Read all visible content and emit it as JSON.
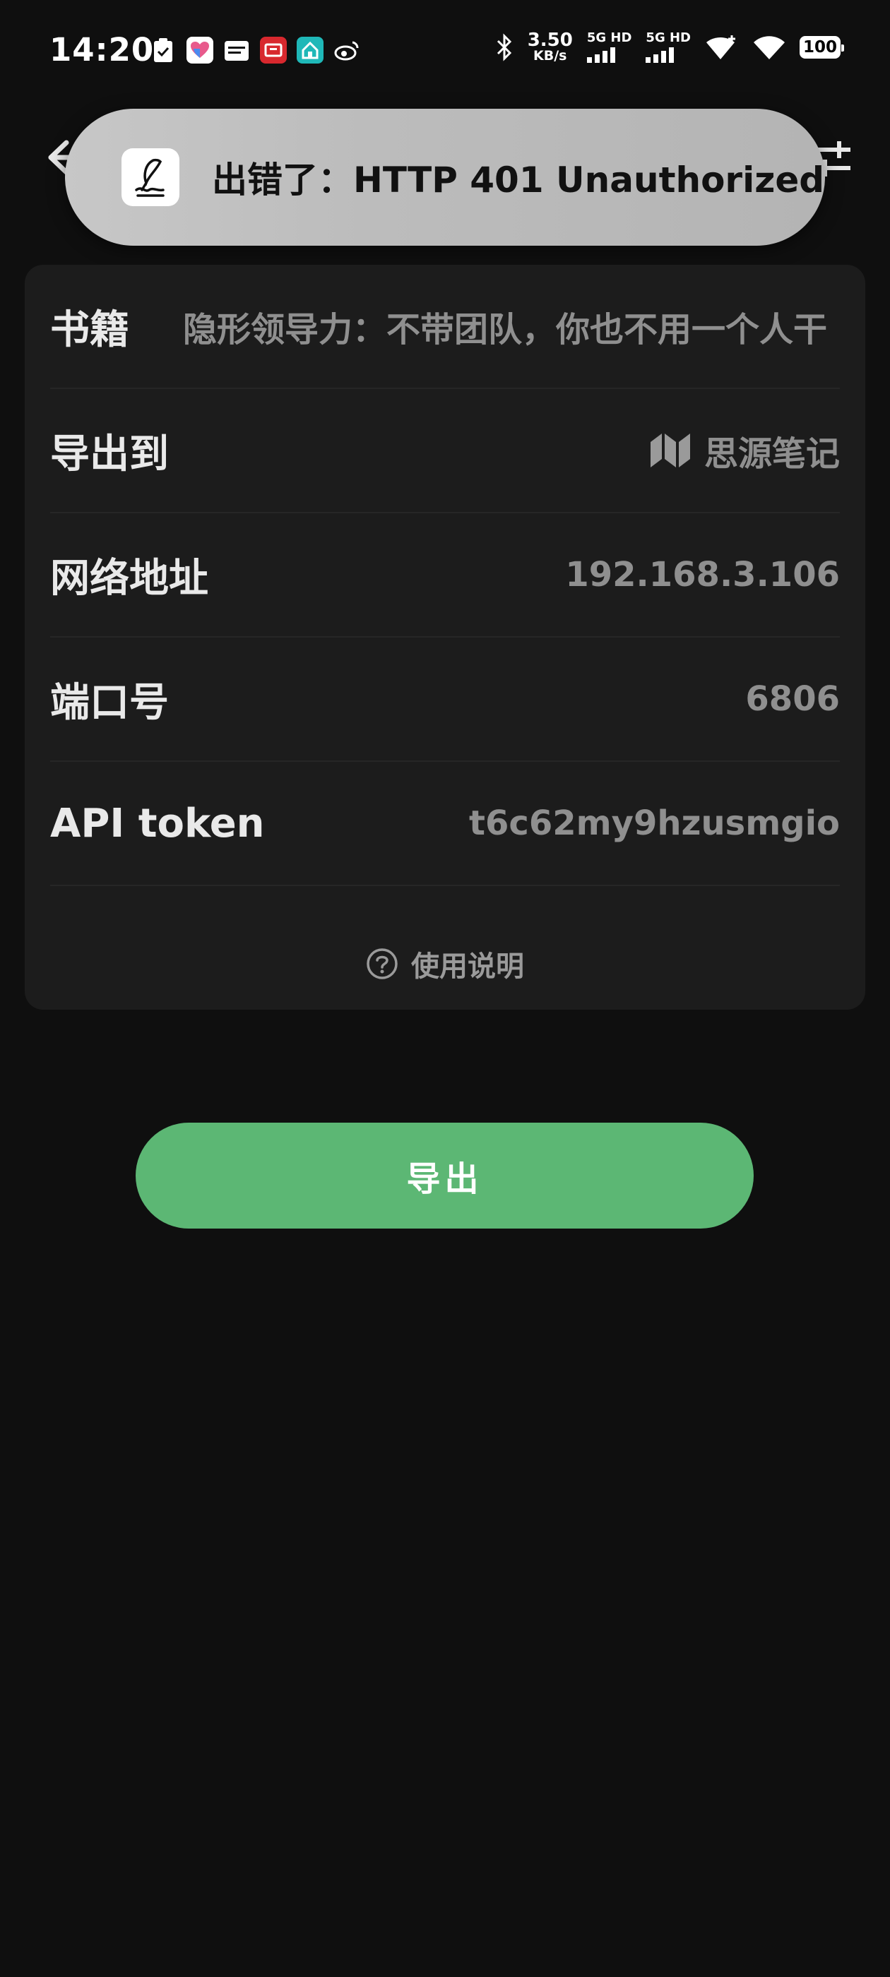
{
  "status_bar": {
    "time": "14:20",
    "net_speed_value": "3.50",
    "net_speed_unit": "KB/s",
    "sim1_label": "5G HD",
    "sim2_label": "5G HD",
    "battery": "100"
  },
  "toast": {
    "message": "出错了：HTTP 401 Unauthorized"
  },
  "settings": {
    "book_label": "书籍",
    "book_value": "隐形领导力：不带团队，你也不用一个人干",
    "export_to_label": "导出到",
    "export_to_value": "思源笔记",
    "address_label": "网络地址",
    "address_value": "192.168.3.106",
    "port_label": "端口号",
    "port_value": "6806",
    "token_label": "API token",
    "token_value": "t6c62my9hzusmgio",
    "help_label": "使用说明"
  },
  "actions": {
    "export_label": "导出"
  },
  "colors": {
    "background": "#0f0f0f",
    "card": "#1c1c1c",
    "accent_green": "#5cb774",
    "toast_bg": "#bcbcbc"
  }
}
